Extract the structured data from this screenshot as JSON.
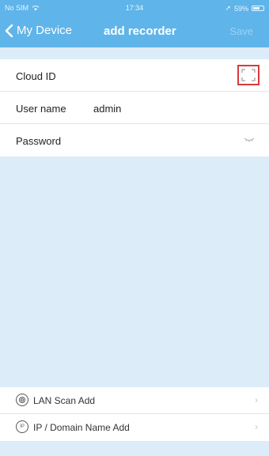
{
  "status": {
    "carrier": "No SIM",
    "time": "17:34",
    "battery": "59%"
  },
  "nav": {
    "back_label": "My Device",
    "title": "add recorder",
    "save_label": "Save"
  },
  "form": {
    "cloud_id_label": "Cloud ID",
    "username_label": "User name",
    "username_value": "admin",
    "password_label": "Password"
  },
  "options": {
    "lan_scan_label": "LAN Scan Add",
    "ip_domain_label": "IP / Domain Name Add",
    "ip_icon_text": "IP"
  }
}
